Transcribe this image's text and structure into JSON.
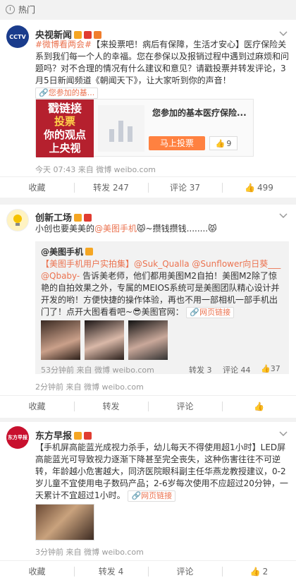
{
  "header": {
    "title": "热门"
  },
  "post1": {
    "author": "央视新闻",
    "avatar_text": "CCTV",
    "text_hashtag": "#微博看两会#",
    "text_body": "【来投票吧！病后有保障，生活才安心】医疗保险关系到我们每一个人的幸福。您在参保以及报销过程中遇到过麻烦和问题吗？对不合理的情况有什么建议和意见？请戳投票并转发评论，3月5日新闻频道《朝闻天下》，让大家听到你的声音！",
    "link_label": "您参加的基...",
    "card_image_lines": [
      "戳链接",
      "投票",
      "你的观点",
      "上央视"
    ],
    "card_title": "您参加的基本医疗保险...",
    "vote_button": "马上投票",
    "vote_count": "9",
    "meta": "今天 07:43 来自 微博 weibo.com",
    "actions": {
      "collect": "收藏",
      "repost": "转发 247",
      "comment": "评论 37",
      "like": "499"
    }
  },
  "post2": {
    "author": "创新工场",
    "text_a": "小创也要美美的",
    "mention": "@美图手机",
    "text_b": "~攒钱攒钱........",
    "fw_author": "@美图手机",
    "fw_tag": "【美图手机用户实拍集】",
    "fw_mentions": "@Suk_Qualla @Sunflower向日葵___ @Qbaby-",
    "fw_body": " 告诉美老师，他们都用美图M2自拍！美图M2除了惊艳的自拍效果之外，专属的MEIOS系统可是美图团队精心设计并开发的哟！方便快捷的操作体验，再也不用一部相机一部手机出门了！点开大图看看吧~",
    "fw_site": "美图官网：",
    "fw_link": "网页链接",
    "fw_meta": "53分钟前 来自 微博 weibo.com",
    "fw_repost": "转发 3",
    "fw_comment": "评论 44",
    "fw_like": "37",
    "meta": "2分钟前 来自 微博 weibo.com",
    "actions": {
      "collect": "收藏",
      "repost": "转发",
      "comment": "评论",
      "like": ""
    }
  },
  "post3": {
    "author": "东方早报",
    "avatar_text": "东方早报",
    "text_body": "【手机屏高能蓝光成视力杀手，幼儿每天不得使用超1小时】LED屏高能蓝光可导致视力逐渐下降甚至完全丧失，这种伤害往往不可逆转，年龄越小危害越大，同济医院眼科副主任华燕龙教授建议，0-2岁儿童不宜使用电子数码产品；2-6岁每次使用不应超过20分钟，一天累计不宜超过1小时。",
    "link": "网页链接",
    "meta": "3分钟前 来自 微博 weibo.com",
    "actions": {
      "collect": "收藏",
      "repost": "转发 4",
      "comment": "评论",
      "like": "2"
    }
  },
  "colors": {
    "accent": "#eb7350",
    "vote_orange": "#ff8140",
    "card_red": "#b5202e"
  }
}
